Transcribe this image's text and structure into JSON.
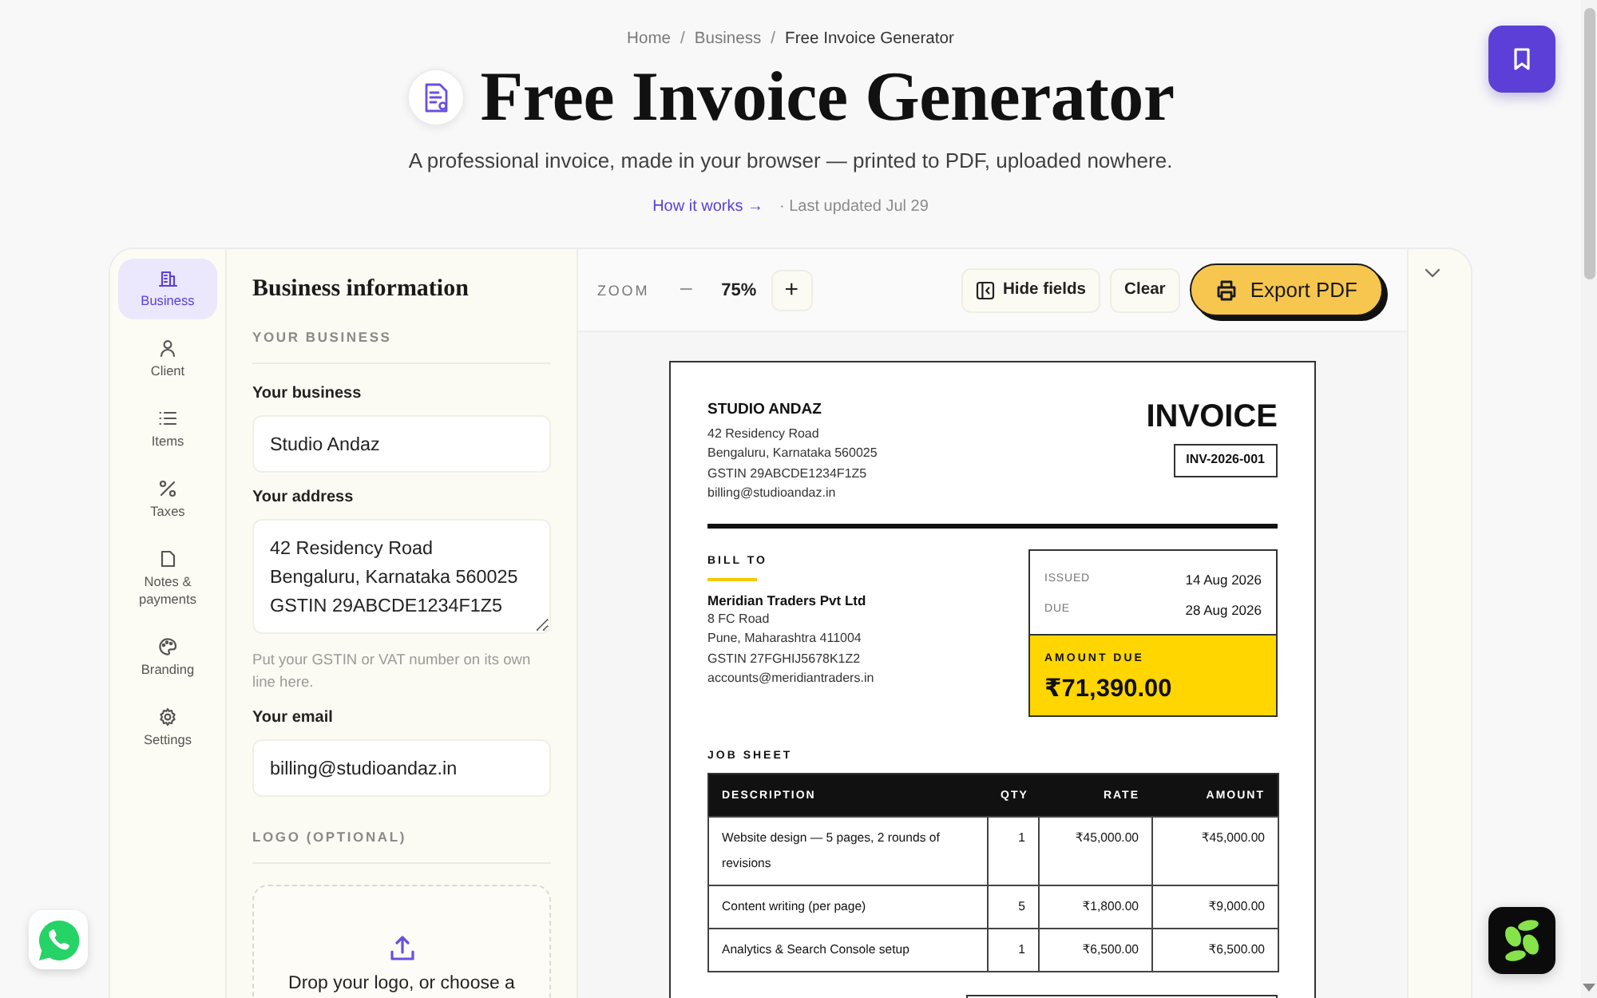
{
  "breadcrumb": {
    "items": [
      {
        "label": "Home",
        "current": false
      },
      {
        "label": "Business",
        "current": false
      },
      {
        "label": "Free Invoice Generator",
        "current": true
      }
    ],
    "separators": [
      "/",
      "/"
    ]
  },
  "header": {
    "title": "Free Invoice Generator",
    "subtitle": "A professional invoice, made in your browser — printed to PDF, uploaded nowhere.",
    "link": "How it works →",
    "updated": "· Last updated Jul 29"
  },
  "sidebar": {
    "items": [
      {
        "label": "Business",
        "selected": true
      },
      {
        "label": "Client",
        "selected": false
      },
      {
        "label": "Items",
        "selected": false
      },
      {
        "label": "Taxes",
        "selected": false
      },
      {
        "label": "Notes & payments",
        "selected": false
      },
      {
        "label": "Branding",
        "selected": false
      },
      {
        "label": "Settings",
        "selected": false
      }
    ]
  },
  "form": {
    "title": "Business information",
    "sections": [
      {
        "heading": "YOUR BUSINESS",
        "fields": [
          {
            "kind": "input",
            "label": "Your business",
            "value": "Studio Andaz"
          },
          {
            "kind": "textarea",
            "label": "Your address",
            "value": "42 Residency Road\nBengaluru, Karnataka 560025\nGSTIN 29ABCDE1234F1Z5",
            "hint": "Put your GSTIN or VAT number on its own line here."
          },
          {
            "kind": "input",
            "label": "Your email",
            "value": "billing@studioandaz.in"
          }
        ]
      },
      {
        "heading": "LOGO (OPTIONAL)",
        "fields": [
          {
            "kind": "dropzone",
            "text": "Drop your logo, or choose a"
          }
        ]
      }
    ]
  },
  "toolbar": {
    "zoom": {
      "label": "ZOOM",
      "decrease": "−",
      "value": "75%",
      "increase": "+"
    },
    "actions": [
      {
        "kind": "toggle_fields",
        "label": "Hide fields"
      },
      {
        "kind": "clear",
        "label": "Clear"
      },
      {
        "kind": "export",
        "label": "Export PDF"
      }
    ]
  },
  "invoice": {
    "from": {
      "name": "STUDIO ANDAZ",
      "lines": [
        "42 Residency Road",
        "Bengaluru, Karnataka 560025",
        "GSTIN 29ABCDE1234F1Z5",
        "billing@studioandaz.in"
      ]
    },
    "title": "INVOICE",
    "number": "INV-2026-001",
    "bill_to": {
      "label": "BILL TO",
      "name": "Meridian Traders Pvt Ltd",
      "lines": [
        "8 FC Road",
        "Pune, Maharashtra 411004",
        "GSTIN 27FGHIJ5678K1Z2",
        "accounts@meridiantraders.in"
      ]
    },
    "dates": [
      {
        "label": "ISSUED",
        "value": "14 Aug 2026"
      },
      {
        "label": "DUE",
        "value": "28 Aug 2026"
      }
    ],
    "amount_due": {
      "label": "AMOUNT DUE",
      "value": "₹71,390.00"
    },
    "items_table": {
      "title": "JOB SHEET",
      "columns": [
        "DESCRIPTION",
        "QTY",
        "RATE",
        "AMOUNT"
      ],
      "rows": [
        [
          "Website design — 5 pages, 2 rounds of revisions",
          "1",
          "₹45,000.00",
          "₹45,000.00"
        ],
        [
          "Content writing (per page)",
          "5",
          "₹1,800.00",
          "₹9,000.00"
        ],
        [
          "Analytics & Search Console setup",
          "1",
          "₹6,500.00",
          "₹6,500.00"
        ]
      ]
    }
  }
}
